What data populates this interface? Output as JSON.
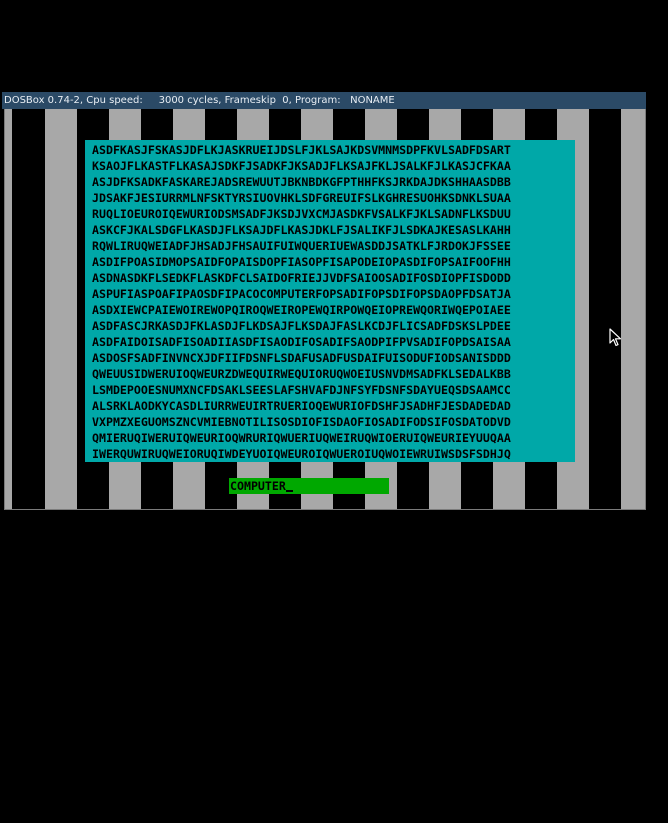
{
  "window": {
    "title": "DOSBox 0.74-2, Cpu speed:     3000 cycles, Frameskip  0, Program:   NONAME"
  },
  "puzzle": {
    "rows": [
      "ASDFKASJFSKASJDFLKJASKRUEIJDSLFJKLSAJKDSVMNMSDPFKVLSADFDSART",
      "KSAOJFLKASTFLKASAJSDKFJSADKFJKSADJFLKSAJFKLJSALKFJLKASJCFKAA",
      "ASJDFKSADKFASKAREJADSREWUUTJBKNBDKGFPTHHFKSJRKDAJDKSHHAASDBB",
      "JDSAKFJESIURRMLNFSKTYRSIUOVHKLSDFGREUIFSLKGHRESUOHKSDNKLSUAA",
      "RUQLIOEUROIQEWURIODSMSADFJKSDJVXCMJASDKFVSALKFJKLSADNFLKSDUU",
      "ASKCFJKALSDGFLKASDJFLKSAJDFLKASJDKLFJSALIKFJLSDKAJKESASLKAHH",
      "RQWLIRUQWEIADFJHSADJFHSAUIFUIWQUERIUEWASDDJSATKLFJRDOKJFSSEE",
      "ASDIFPOASIDMOPSAIDFOPAISDOPFIASOPFISAPODEIOPASDIFOPSAIFOOFHH",
      "ASDNASDKFLSEDKFLASKDFCLSAIDOFRIEJJVDFSAIOOSADIFOSDIOPFISDODD",
      "ASPUFIASPOAFIPAOSDFIPACOCOMPUTERFOPSADIFOPSDIFOPSDAOPFDSATJA",
      "ASDXIEWCPAIEWOIREWOPQIROQWEIROPEWQIRPOWQEIOPREWQORIWQEPOIAEE",
      "ASDFASCJRKASDJFKLASDJFLKDSAJFLKSDAJFASLKCDJFLICSADFDSKSLPDEE",
      "ASDFAIDOISADFISOADIIASDFISAODIFOSADIFSAODPIFPVSADIFOPDSAISAA",
      "ASDOSFSADFINVNCXJDFIIFDSNFLSDAFUSADFUSDAIFUISODUFIODSANISDDD",
      "QWEUUSIDWERUIOQWEURZDWEQUIRWEQUIORUQWOEIUSNVDMSADFKLSEDALKBB",
      "LSMDEPOOESNUMXNCFDSAKLSEESLAFSHVAFDJNFSYFDSNFSDAYUEQSDSAAMCC",
      "ALSRKLAODKYCASDLIURRWEUIRTRUERIOQEWURIOFDSHFJSADHFJESDADEDAD",
      "VXPMZXEGUOMSZNCVMIEBNOTILISOSDIOFISDAOFIOSADIFODSIFOSDATODVD",
      "QMIERUQIWERUIQWEURIOQWRURIQWUERIUQWEIRUQWIOERUIQWEURIEYUUQAA",
      "IWERQUWIRUQWEIORUQIWDEYUOIQWEUROIQWUEROIUQWOIEWRUIWSDSFSDHJQ"
    ]
  },
  "input": {
    "value": "COMPUTER"
  },
  "colors": {
    "titlebar": "#2b4a66",
    "grid_background": "#00a8a8",
    "input_background": "#00a800",
    "stripe": "#a8a8a8"
  }
}
